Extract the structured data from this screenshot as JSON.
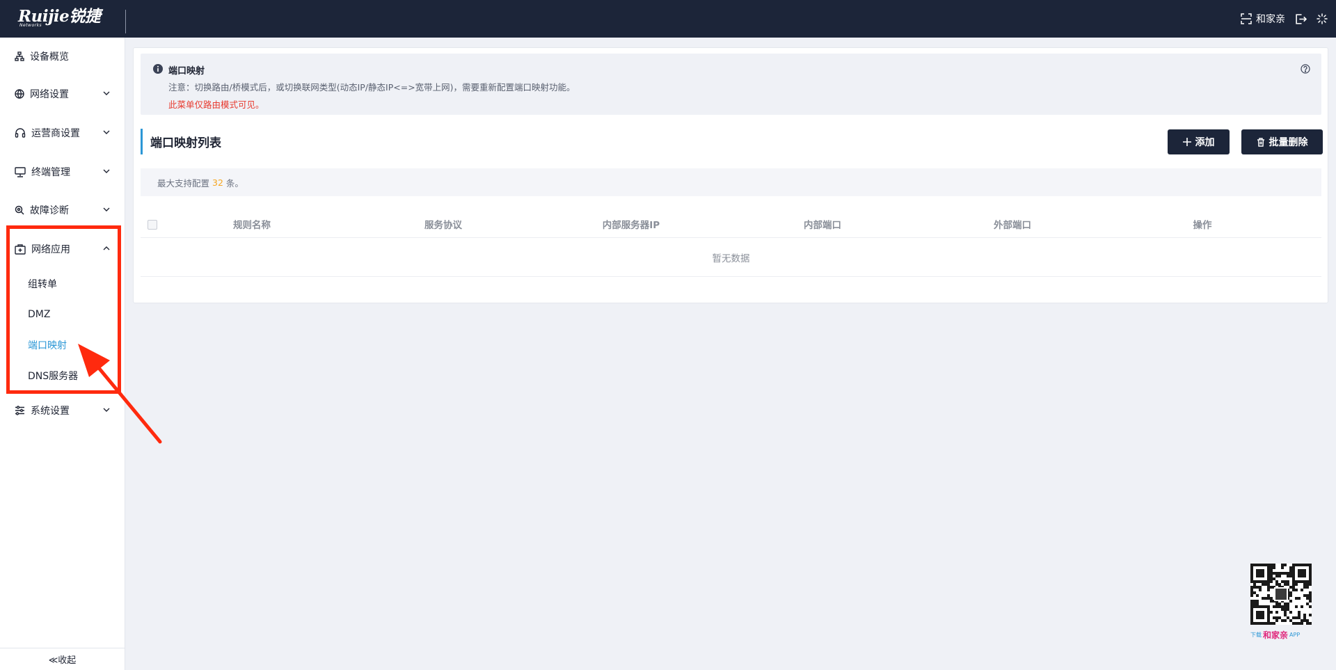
{
  "header": {
    "brand": "Ruijie锐捷",
    "brand_sub": "Networks",
    "app_name": "和家亲"
  },
  "sidebar": {
    "items": [
      {
        "label": "设备概览",
        "icon": "network-tree-icon"
      },
      {
        "label": "网络设置",
        "icon": "globe-icon"
      },
      {
        "label": "运营商设置",
        "icon": "headset-icon"
      },
      {
        "label": "终端管理",
        "icon": "monitor-icon"
      },
      {
        "label": "故障诊断",
        "icon": "search-gear-icon"
      },
      {
        "label": "网络应用",
        "icon": "medkit-icon",
        "expanded": true
      },
      {
        "label": "系统设置",
        "icon": "sliders-icon"
      }
    ],
    "subitems": [
      {
        "label": "组转单"
      },
      {
        "label": "DMZ"
      },
      {
        "label": "端口映射",
        "active": true
      },
      {
        "label": "DNS服务器"
      }
    ],
    "collapse_label": "≪收起"
  },
  "notice": {
    "title": "端口映射",
    "line1": "注意：切换路由/桥模式后，或切换联网类型(动态IP/静态IP<=>宽带上网)，需要重新配置端口映射功能。",
    "line2": "此菜单仅路由模式可见。"
  },
  "section": {
    "title": "端口映射列表",
    "add_label": "添加",
    "delete_label": "批量删除"
  },
  "info_bar": {
    "prefix": "最大支持配置",
    "count": "32",
    "suffix": "条。"
  },
  "table": {
    "columns": [
      "规则名称",
      "服务协议",
      "内部服务器IP",
      "内部端口",
      "外部端口",
      "操作"
    ],
    "empty_text": "暂无数据"
  },
  "qr": {
    "caption_prefix": "下载",
    "caption_name": "和家亲",
    "caption_suffix": "APP"
  },
  "colors": {
    "header_bg": "#1c2539",
    "accent": "#2c97d6",
    "warning": "#e83a2f",
    "count": "#f5a623",
    "annotation": "#ff2a0e"
  }
}
